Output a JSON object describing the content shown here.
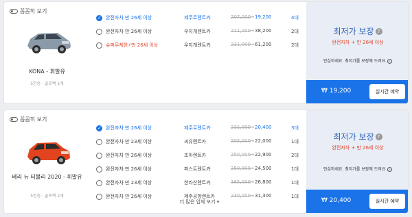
{
  "cards": [
    {
      "peek_label": "꼼꼼히 보기",
      "car_name": "KONA - 휘발유",
      "car_spec": "5인승 · 골프백 1개",
      "rows": [
        {
          "ins": "완전자차",
          "age": "만 26세 이상",
          "company": "제주로렌트카",
          "orig": "207,000",
          "price": "19,200",
          "count": "4대",
          "selected": true,
          "warn": false
        },
        {
          "ins": "완전자차",
          "age": "만 26세 이상",
          "company": "우지개렌트카",
          "orig": "211,000",
          "price": "38,200",
          "count": "2대",
          "selected": false,
          "warn": false
        },
        {
          "ins": "슈퍼무제한",
          "age": "만 26세 이상",
          "company": "우지개렌트카",
          "orig": "231,000",
          "price": "61,200",
          "count": "2대",
          "selected": false,
          "warn": true
        }
      ],
      "panel": {
        "title": "최저가 보장",
        "subtitle": "완전자차 + 만 26세 이상",
        "note": "안심하세요. 최저가를 보장해 드려요."
      },
      "price_label": "₩ 19,200",
      "book_label": "실시간 예약"
    },
    {
      "peek_label": "꼼꼼히 보기",
      "car_name": "베리 뉴 티볼리 2020 - 휘발유",
      "car_spec": "5인승 · 골프백 2개",
      "rows": [
        {
          "ins": "완전자차",
          "age": "만 26세 이상",
          "company": "제주로렌트카",
          "orig": "231,000",
          "price": "20,400",
          "count": "3대",
          "selected": true,
          "warn": false
        },
        {
          "ins": "완전자차",
          "age": "만 23세 이상",
          "company": "씨유렌트카",
          "orig": "205,000",
          "price": "22,000",
          "count": "1대",
          "selected": false,
          "warn": false
        },
        {
          "ins": "완전자차",
          "age": "만 26세 이상",
          "company": "조아렌트카",
          "orig": "250,000",
          "price": "22,900",
          "count": "2대",
          "selected": false,
          "warn": false
        },
        {
          "ins": "완전자차",
          "age": "만 26세 이상",
          "company": "퍼스트렌트카",
          "orig": "250,000",
          "price": "24,500",
          "count": "1대",
          "selected": false,
          "warn": false
        },
        {
          "ins": "완전자차",
          "age": "만 23세 이상",
          "company": "한라산렌트카",
          "orig": "165,000",
          "price": "26,800",
          "count": "1대",
          "selected": false,
          "warn": false
        },
        {
          "ins": "완전자차",
          "age": "만 26세 이상",
          "company": "제주공항렌트카",
          "orig": "230,000",
          "price": "31,300",
          "count": "1대",
          "selected": false,
          "warn": false
        }
      ],
      "more_label": "더 많은 업체 보기",
      "panel": {
        "title": "최저가 보장",
        "subtitle": "완전자차 + 만 26세 이상",
        "note": "안심하세요. 최저가를 보장해 드려요."
      },
      "price_label": "₩ 20,400",
      "book_label": "실시간 예약"
    }
  ],
  "colors": {
    "accent": "#1a73e8",
    "warning": "#e0452d",
    "panel_bg": "#e8edf6",
    "car1": "#8a9aa8",
    "car2": "#e2441f"
  },
  "icons": {
    "peek": "toggle-icon",
    "help": "question-circle-icon",
    "note": "arrow-circle-icon",
    "more": "caret-down-icon",
    "bolt": "lightning-icon"
  }
}
